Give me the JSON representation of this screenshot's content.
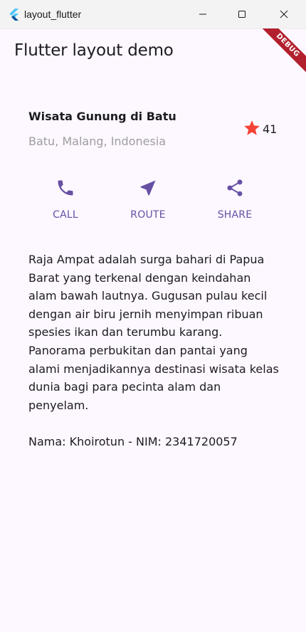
{
  "window": {
    "title": "layout_flutter"
  },
  "appbar": {
    "title": "Flutter layout demo",
    "debug_banner": "DEBUG"
  },
  "place": {
    "title": "Wisata Gunung di Batu",
    "subtitle": "Batu, Malang, Indonesia",
    "rating": "41",
    "star_color": "#f44336"
  },
  "actions": [
    {
      "label": "CALL",
      "icon": "phone-icon"
    },
    {
      "label": "ROUTE",
      "icon": "navigation-icon"
    },
    {
      "label": "SHARE",
      "icon": "share-icon"
    }
  ],
  "accent_color": "#6750a4",
  "description": "Raja Ampat adalah surga bahari di Papua Barat yang terkenal dengan keindahan alam bawah lautnya. Gugusan pulau kecil dengan air biru jernih menyimpan ribuan spesies ikan dan terumbu karang. Panorama perbukitan dan pantai yang alami menjadikannya destinasi wisata kelas dunia bagi para pecinta alam dan penyelam.\n\nNama: Khoirotun - NIM: 2341720057"
}
